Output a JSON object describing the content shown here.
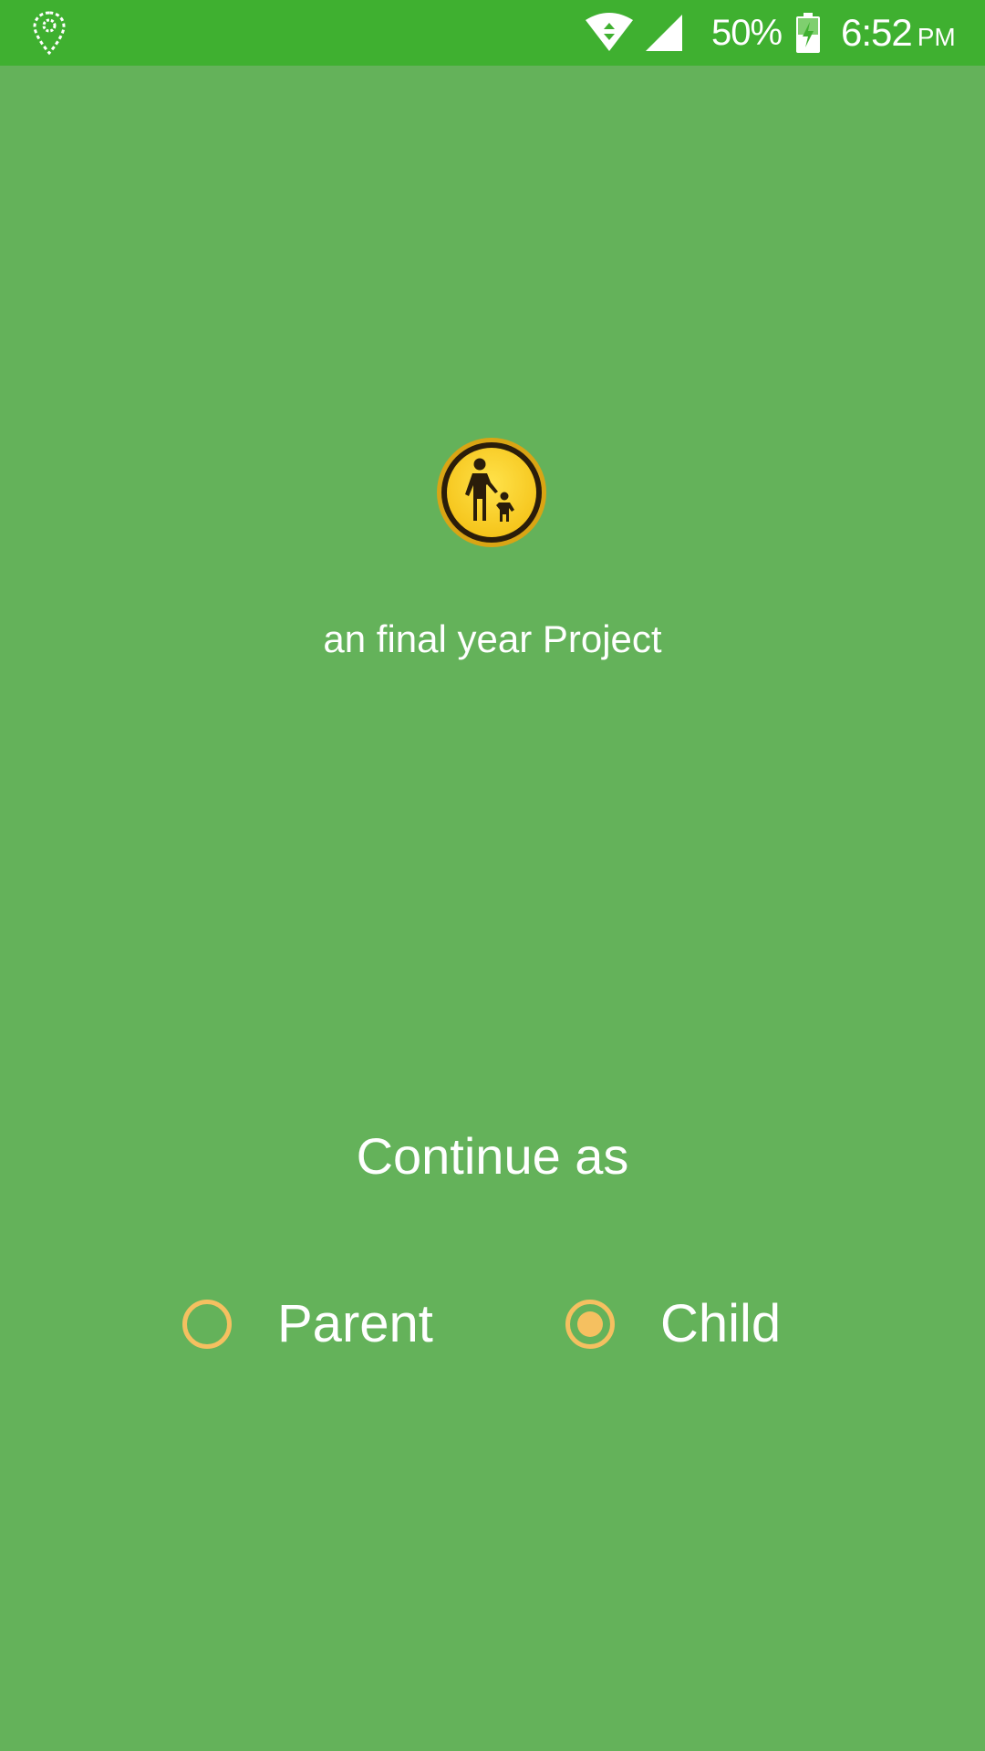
{
  "status_bar": {
    "battery_percent": "50%",
    "time": "6:52",
    "ampm": "PM",
    "icons": [
      "location-pin-icon",
      "wifi-icon",
      "cell-signal-icon",
      "battery-charging-icon"
    ]
  },
  "logo": {
    "icon": "parent-child-icon"
  },
  "tagline": "an final year Project",
  "role_select": {
    "heading": "Continue as",
    "options": [
      {
        "label": "Parent",
        "selected": false
      },
      {
        "label": "Child",
        "selected": true
      }
    ]
  },
  "colors": {
    "background": "#64b25a",
    "status_bar": "#3fb030",
    "accent": "#f5c060",
    "logo_yellow": "#fcd62c"
  }
}
